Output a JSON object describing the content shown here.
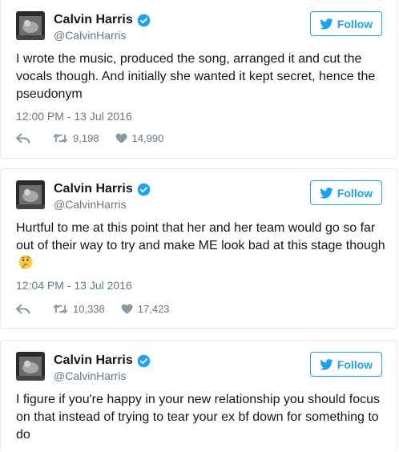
{
  "tweets": [
    {
      "author": "Calvin Harris",
      "handle": "@CalvinHarris",
      "follow_label": "Follow",
      "text": "I wrote the music, produced the song, arranged it and cut the vocals though. And initially she wanted it kept secret, hence the pseudonym",
      "timestamp": "12:00 PM - 13 Jul 2016",
      "retweets": "9,198",
      "likes": "14,990"
    },
    {
      "author": "Calvin Harris",
      "handle": "@CalvinHarris",
      "follow_label": "Follow",
      "text": "Hurtful to me at this point that her and her team would go so far out of their way to try and make ME look bad at this stage though",
      "emoji": "thinking-face",
      "timestamp": "12:04 PM - 13 Jul 2016",
      "retweets": "10,338",
      "likes": "17,423"
    },
    {
      "author": "Calvin Harris",
      "handle": "@CalvinHarris",
      "follow_label": "Follow",
      "text": "I figure if you're happy in your new relationship you should focus on that instead of trying to tear your ex bf down for something to do"
    }
  ],
  "colors": {
    "twitter_blue": "#1da1f2",
    "gray": "#657786",
    "border": "#e1e8ed"
  },
  "icons": [
    "twitter-bird-icon",
    "verified-badge-icon",
    "reply-icon",
    "retweet-icon",
    "heart-icon",
    "thinking-face-emoji"
  ]
}
